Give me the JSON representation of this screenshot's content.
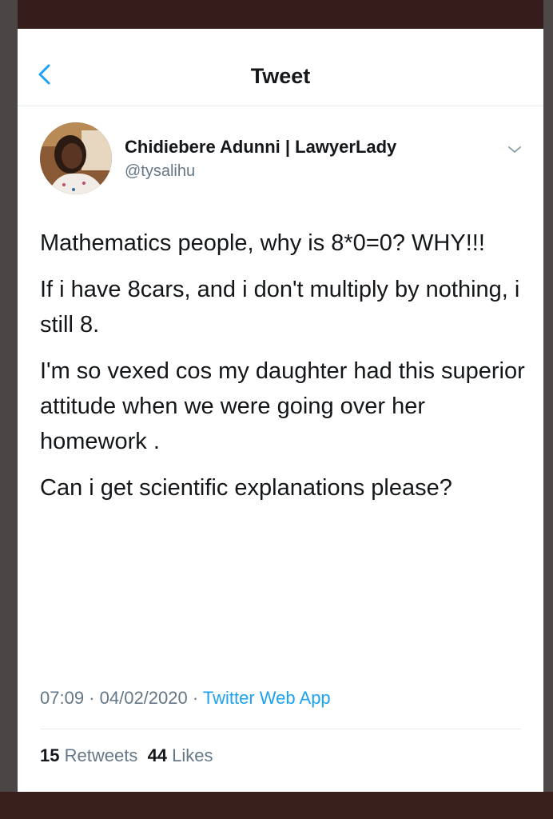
{
  "header": {
    "title": "Tweet",
    "back_icon": "chevron-left-icon"
  },
  "author": {
    "display_name": "Chidiebere Adunni | LawyerLady",
    "handle": "@tysalihu",
    "menu_icon": "chevron-down-icon"
  },
  "tweet": {
    "paragraphs": [
      "Mathematics people,  why is 8*0=0? WHY!!!",
      "If i have 8cars,  and i don't multiply by nothing, i still 8.",
      "I'm so vexed cos my daughter had this superior attitude when we were going over her homework .",
      "Can i get scientific explanations please?"
    ]
  },
  "meta": {
    "time": "07:09",
    "date": "04/02/2020",
    "separator": " · ",
    "source": "Twitter Web App"
  },
  "stats": {
    "retweets_count": "15",
    "retweets_label": "Retweets",
    "likes_count": "44",
    "likes_label": "Likes"
  },
  "colors": {
    "accent": "#1da1f2",
    "text": "#14171a",
    "secondary": "#657786"
  }
}
